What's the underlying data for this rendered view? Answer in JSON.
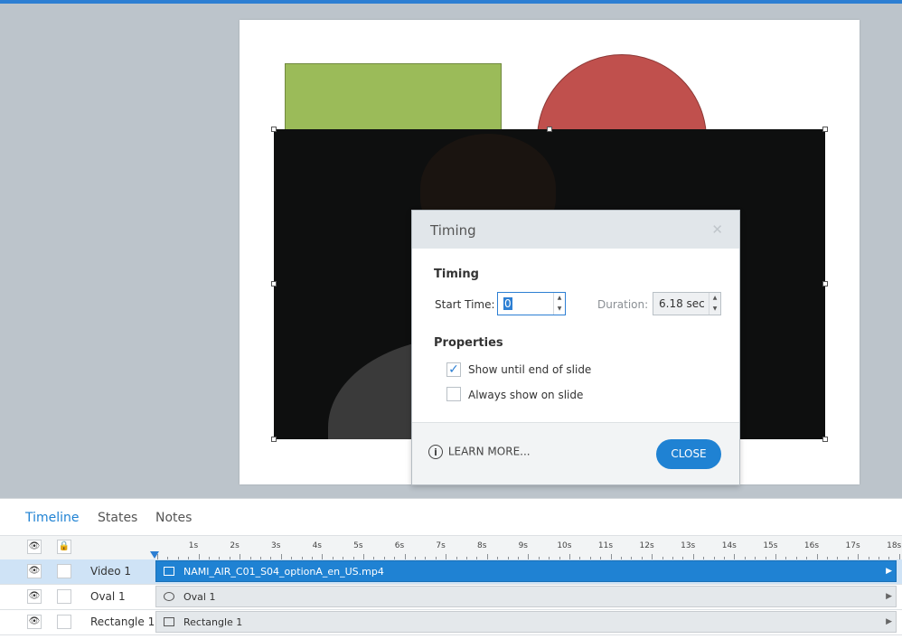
{
  "dialog": {
    "title": "Timing",
    "timing_section": "Timing",
    "start_time_label": "Start Time:",
    "start_time_value": "0",
    "duration_label": "Duration:",
    "duration_value": "6.18 sec",
    "properties_section": "Properties",
    "options": [
      {
        "label": "Show until end of slide",
        "checked": true
      },
      {
        "label": "Always show on slide",
        "checked": false
      }
    ],
    "learn_more": "LEARN MORE...",
    "close": "CLOSE"
  },
  "timeline": {
    "tabs": [
      "Timeline",
      "States",
      "Notes"
    ],
    "active_tab": "Timeline",
    "ruler": [
      "1s",
      "2s",
      "3s",
      "4s",
      "5s",
      "6s",
      "7s",
      "8s",
      "9s",
      "10s",
      "11s",
      "12s",
      "13s",
      "14s",
      "15s",
      "16s",
      "17s",
      "18s"
    ],
    "rows": [
      {
        "name": "Video 1",
        "bar_label": "NAMI_AIR_C01_S04_optionA_en_US.mp4",
        "icon": "video-icon",
        "selected": true
      },
      {
        "name": "Oval 1",
        "bar_label": "Oval 1",
        "icon": "oval-icon",
        "selected": false
      },
      {
        "name": "Rectangle 1",
        "bar_label": "Rectangle 1",
        "icon": "rectangle-icon",
        "selected": false
      }
    ]
  },
  "colors": {
    "accent": "#1f82d3",
    "rectangle_fill": "#9bbb59",
    "oval_fill": "#c0504d"
  }
}
